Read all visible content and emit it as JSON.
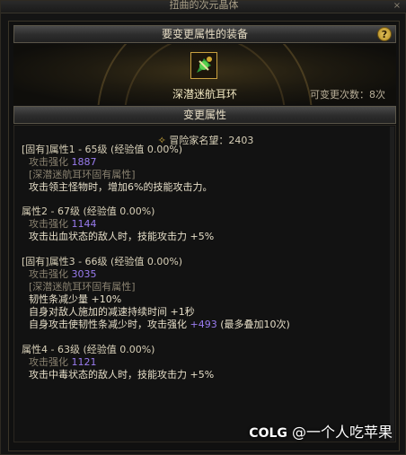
{
  "window": {
    "title": "扭曲的次元晶体",
    "close": "×"
  },
  "header": {
    "title": "要变更属性的装备",
    "help": "?"
  },
  "equipment": {
    "name": "深潜迷航耳环",
    "remaining": "可变更次数：8次",
    "icon": "earring-icon"
  },
  "section": {
    "title": "变更属性"
  },
  "adventure": {
    "label": "冒险家名望：2403",
    "icon": "medal-icon"
  },
  "attributes": [
    {
      "header": "[固有]属性1 - 65级 (经验值 0.00%)",
      "strength_label": "攻击强化",
      "strength_value": "1887",
      "origin": "[深潜迷航耳环固有属性]",
      "effects": [
        "攻击领主怪物时，增加6%的技能攻击力。"
      ]
    },
    {
      "header": "属性2 - 67级 (经验值 0.00%)",
      "strength_label": "攻击强化",
      "strength_value": "1144",
      "origin": "",
      "effects": [
        "攻击出血状态的敌人时，技能攻击力 +5%"
      ]
    },
    {
      "header": "[固有]属性3 - 66级 (经验值 0.00%)",
      "strength_label": "攻击强化",
      "strength_value": "3035",
      "origin": "[深潜迷航耳环固有属性]",
      "effects": [
        "韧性条减少量 +10%",
        "自身对敌人施加的减速持续时间 +1秒",
        "自身攻击使韧性条减少时，攻击强化 +493 (最多叠加10次)"
      ]
    },
    {
      "header": "属性4 - 63级 (经验值 0.00%)",
      "strength_label": "攻击强化",
      "strength_value": "1121",
      "origin": "",
      "effects": [
        "攻击中毒状态的敌人时，技能攻击力 +5%"
      ]
    }
  ],
  "watermark": {
    "logo": "COLG",
    "text": "@一个人吃苹果"
  }
}
